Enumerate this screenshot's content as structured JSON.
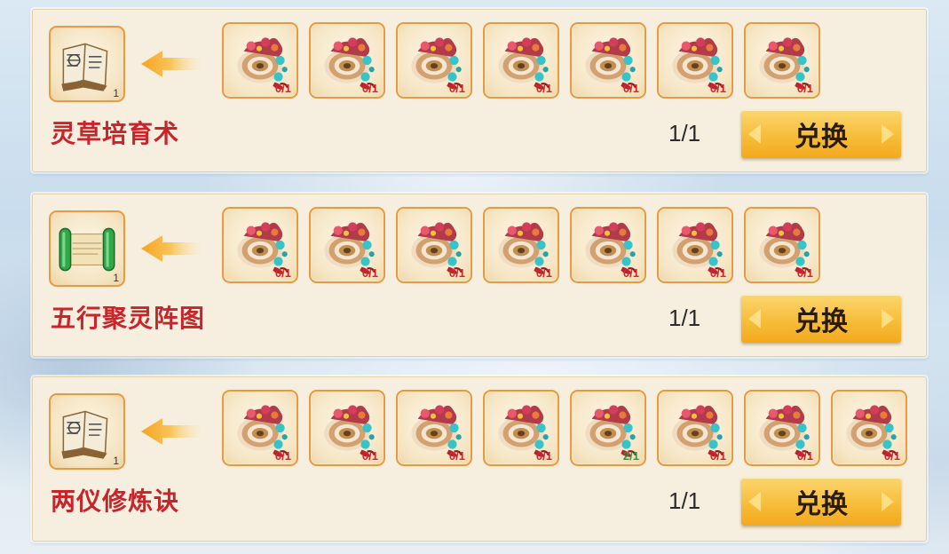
{
  "recipes": [
    {
      "name": "灵草培育术",
      "target_icon": "book-icon",
      "target_qty": "1",
      "progress": "1/1",
      "button_label": "兑换",
      "materials": [
        "0/1",
        "0/1",
        "0/1",
        "0/1",
        "0/1",
        "0/1",
        "0/1"
      ]
    },
    {
      "name": "五行聚灵阵图",
      "target_icon": "scroll-icon",
      "target_qty": "1",
      "progress": "1/1",
      "button_label": "兑换",
      "materials": [
        "0/1",
        "0/1",
        "0/1",
        "0/1",
        "0/1",
        "0/1",
        "0/1"
      ]
    },
    {
      "name": "两仪修炼诀",
      "target_icon": "book-icon",
      "target_qty": "1",
      "progress": "1/1",
      "button_label": "兑换",
      "materials": [
        "0/1",
        "0/1",
        "0/1",
        "0/1",
        "2/1",
        "0/1",
        "0/1",
        "0/1"
      ]
    }
  ],
  "material_icon": "jeweled-shell-icon",
  "colors": {
    "name_red": "#c9242a",
    "count_red": "#d3252b",
    "count_green": "#2c9a3b",
    "slot_border": "#e79a3f",
    "button_gold": "#f7bd3a"
  }
}
